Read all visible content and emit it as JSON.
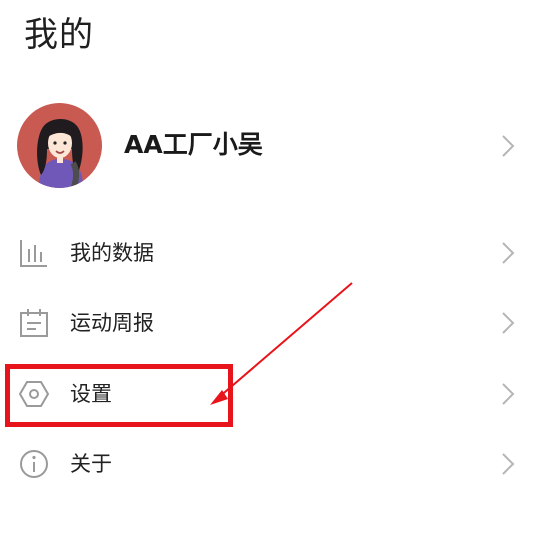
{
  "page": {
    "title": "我的"
  },
  "profile": {
    "name": "AA工厂小吴"
  },
  "menu": {
    "items": [
      {
        "label": "我的数据",
        "icon": "bar-chart-icon"
      },
      {
        "label": "运动周报",
        "icon": "calendar-report-icon"
      },
      {
        "label": "设置",
        "icon": "hexagon-settings-icon"
      },
      {
        "label": "关于",
        "icon": "info-icon"
      }
    ]
  },
  "annotation": {
    "highlight_color": "#e8141b",
    "highlighted_item": "设置"
  },
  "colors": {
    "icon_gray": "#9a9a9a",
    "chevron_gray": "#b5b5b5",
    "avatar_bg": "#c8504a"
  }
}
